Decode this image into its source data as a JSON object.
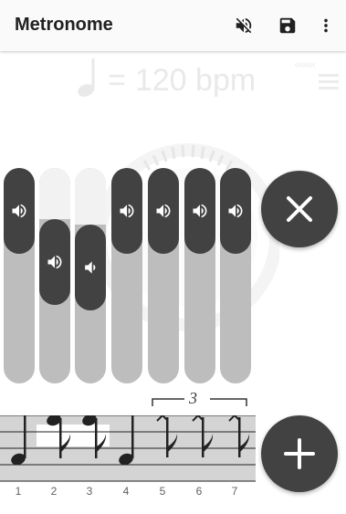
{
  "app": {
    "title": "Metronome",
    "actions": [
      {
        "name": "mute-toggle",
        "icon": "volume-off-icon"
      },
      {
        "name": "save",
        "icon": "save-icon"
      },
      {
        "name": "overflow-menu",
        "icon": "more-vert-icon"
      }
    ]
  },
  "tempo": {
    "note_icon": "quarter-note-icon",
    "equals": "=",
    "value_text": "120 bpm"
  },
  "speed_indicator_icon": "chevrons-left-icon",
  "tempo_list_icon": "list-icon",
  "beats": [
    {
      "number": "1",
      "volume": 0.85,
      "note": "quarter"
    },
    {
      "number": "2",
      "volume": 0.63,
      "note": "eighth"
    },
    {
      "number": "3",
      "volume": 0.55,
      "note": "eighth"
    },
    {
      "number": "4",
      "volume": 0.85,
      "note": "quarter"
    },
    {
      "number": "5",
      "volume": 0.85,
      "note": "triplet-eighth-x"
    },
    {
      "number": "6",
      "volume": 0.85,
      "note": "triplet-eighth-x"
    },
    {
      "number": "7",
      "volume": 0.85,
      "note": "triplet-eighth-x"
    }
  ],
  "triplet_label": "3",
  "buttons": {
    "remove": "close-icon",
    "add": "plus-icon"
  },
  "colors": {
    "dark": "#424242",
    "track": "#bdbdbd",
    "track_empty": "#f2f2f2"
  }
}
